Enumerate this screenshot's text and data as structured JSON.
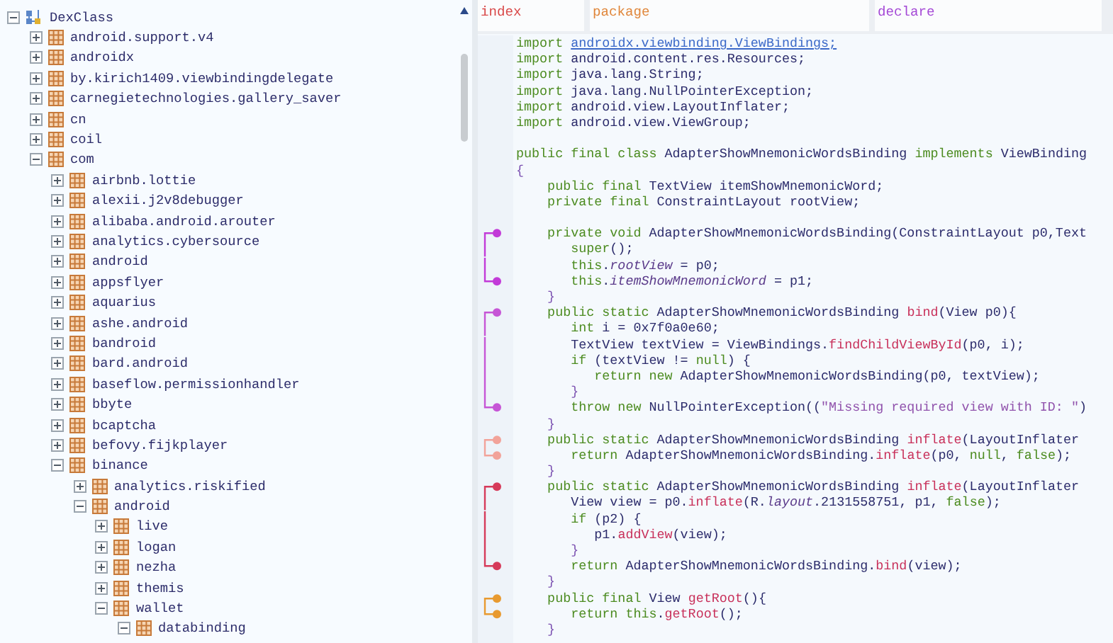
{
  "tree": {
    "label": "DexClass",
    "kind": "root",
    "expanded": true,
    "children": [
      {
        "label": "android.support.v4",
        "kind": "package",
        "expanded": false
      },
      {
        "label": "androidx",
        "kind": "package",
        "expanded": false
      },
      {
        "label": "by.kirich1409.viewbindingdelegate",
        "kind": "package",
        "expanded": false
      },
      {
        "label": "carnegietechnologies.gallery_saver",
        "kind": "package",
        "expanded": false
      },
      {
        "label": "cn",
        "kind": "package",
        "expanded": false
      },
      {
        "label": "coil",
        "kind": "package",
        "expanded": false
      },
      {
        "label": "com",
        "kind": "package",
        "expanded": true,
        "children": [
          {
            "label": "airbnb.lottie",
            "kind": "package",
            "expanded": false
          },
          {
            "label": "alexii.j2v8debugger",
            "kind": "package",
            "expanded": false
          },
          {
            "label": "alibaba.android.arouter",
            "kind": "package",
            "expanded": false
          },
          {
            "label": "analytics.cybersource",
            "kind": "package",
            "expanded": false
          },
          {
            "label": "android",
            "kind": "package",
            "expanded": false
          },
          {
            "label": "appsflyer",
            "kind": "package",
            "expanded": false
          },
          {
            "label": "aquarius",
            "kind": "package",
            "expanded": false
          },
          {
            "label": "ashe.android",
            "kind": "package",
            "expanded": false
          },
          {
            "label": "bandroid",
            "kind": "package",
            "expanded": false
          },
          {
            "label": "bard.android",
            "kind": "package",
            "expanded": false
          },
          {
            "label": "baseflow.permissionhandler",
            "kind": "package",
            "expanded": false
          },
          {
            "label": "bbyte",
            "kind": "package",
            "expanded": false
          },
          {
            "label": "bcaptcha",
            "kind": "package",
            "expanded": false
          },
          {
            "label": "befovy.fijkplayer",
            "kind": "package",
            "expanded": false
          },
          {
            "label": "binance",
            "kind": "package",
            "expanded": true,
            "children": [
              {
                "label": "analytics.riskified",
                "kind": "package",
                "expanded": false
              },
              {
                "label": "android",
                "kind": "package",
                "expanded": true,
                "children": [
                  {
                    "label": "live",
                    "kind": "package",
                    "expanded": false
                  },
                  {
                    "label": "logan",
                    "kind": "package",
                    "expanded": false
                  },
                  {
                    "label": "nezha",
                    "kind": "package",
                    "expanded": false
                  },
                  {
                    "label": "themis",
                    "kind": "package",
                    "expanded": false
                  },
                  {
                    "label": "wallet",
                    "kind": "package",
                    "expanded": true,
                    "children": [
                      {
                        "label": "databinding",
                        "kind": "package",
                        "expanded": true
                      }
                    ]
                  }
                ]
              }
            ]
          }
        ]
      }
    ]
  },
  "columns": [
    {
      "label": "index",
      "color": "#d94848"
    },
    {
      "label": "package",
      "color": "#e0863a"
    },
    {
      "label": "declare",
      "color": "#a448d6"
    }
  ],
  "code_lines": [
    {
      "kind": "code",
      "tokens": [
        {
          "kind": "kw",
          "text": "import "
        },
        {
          "kind": "link",
          "text": "androidx.viewbinding.ViewBindings;"
        }
      ]
    },
    {
      "kind": "code",
      "tokens": [
        {
          "kind": "kw",
          "text": "import "
        },
        {
          "kind": "type",
          "text": "android.content.res.Resources;"
        }
      ]
    },
    {
      "kind": "code",
      "tokens": [
        {
          "kind": "kw",
          "text": "import "
        },
        {
          "kind": "type",
          "text": "java.lang.String;"
        }
      ]
    },
    {
      "kind": "code",
      "tokens": [
        {
          "kind": "kw",
          "text": "import "
        },
        {
          "kind": "type",
          "text": "java.lang.NullPointerException;"
        }
      ]
    },
    {
      "kind": "code",
      "tokens": [
        {
          "kind": "kw",
          "text": "import "
        },
        {
          "kind": "type",
          "text": "android.view.LayoutInflater;"
        }
      ]
    },
    {
      "kind": "code",
      "tokens": [
        {
          "kind": "kw",
          "text": "import "
        },
        {
          "kind": "type",
          "text": "android.view.ViewGroup;"
        }
      ]
    },
    {
      "kind": "blank"
    },
    {
      "kind": "code",
      "tokens": [
        {
          "kind": "kw",
          "text": "public final class "
        },
        {
          "kind": "type",
          "text": "AdapterShowMnemonicWordsBinding "
        },
        {
          "kind": "kw",
          "text": "implements "
        },
        {
          "kind": "type",
          "text": "ViewBinding"
        }
      ]
    },
    {
      "kind": "code",
      "tokens": [
        {
          "kind": "brace",
          "text": "{"
        }
      ]
    },
    {
      "kind": "code",
      "tokens": [
        {
          "kind": "kw",
          "text": "    public final "
        },
        {
          "kind": "type",
          "text": "TextView itemShowMnemonicWord;"
        }
      ]
    },
    {
      "kind": "code",
      "tokens": [
        {
          "kind": "kw",
          "text": "    private final "
        },
        {
          "kind": "type",
          "text": "ConstraintLayout rootView;"
        }
      ]
    },
    {
      "kind": "blank"
    },
    {
      "kind": "code",
      "bracket": {
        "opens": true,
        "closes": false,
        "color": "#c23ad8"
      },
      "tokens": [
        {
          "kind": "kw",
          "text": "    private void "
        },
        {
          "kind": "type",
          "text": "AdapterShowMnemonicWordsBinding(ConstraintLayout p0,Text"
        }
      ]
    },
    {
      "kind": "code",
      "bracket": {
        "opens": false,
        "closes": false,
        "color": "#c23ad8"
      },
      "tokens": [
        {
          "kind": "kw",
          "text": "       super"
        },
        {
          "kind": "type",
          "text": "();"
        }
      ]
    },
    {
      "kind": "code",
      "bracket": {
        "opens": false,
        "closes": false,
        "color": "#c23ad8"
      },
      "tokens": [
        {
          "kind": "kw",
          "text": "       this"
        },
        {
          "kind": "type",
          "text": "."
        },
        {
          "kind": "field",
          "text": "rootView"
        },
        {
          "kind": "type",
          "text": " = p0;"
        }
      ]
    },
    {
      "kind": "code",
      "bracket": {
        "opens": false,
        "closes": true,
        "color": "#c23ad8"
      },
      "tokens": [
        {
          "kind": "kw",
          "text": "       this"
        },
        {
          "kind": "type",
          "text": "."
        },
        {
          "kind": "field",
          "text": "itemShowMnemonicWord"
        },
        {
          "kind": "type",
          "text": " = p1;"
        }
      ]
    },
    {
      "kind": "code",
      "tokens": [
        {
          "kind": "brace",
          "text": "    }"
        }
      ]
    },
    {
      "kind": "code",
      "bracket": {
        "opens": true,
        "closes": false,
        "color": "#c655d6"
      },
      "tokens": [
        {
          "kind": "kw",
          "text": "    public static "
        },
        {
          "kind": "type",
          "text": "AdapterShowMnemonicWordsBinding "
        },
        {
          "kind": "fn",
          "text": "bind"
        },
        {
          "kind": "type",
          "text": "(View p0){"
        }
      ]
    },
    {
      "kind": "code",
      "bracket": {
        "opens": false,
        "closes": false,
        "color": "#c655d6"
      },
      "tokens": [
        {
          "kind": "kw",
          "text": "       int "
        },
        {
          "kind": "type",
          "text": "i = 0x7f0a0e60;"
        }
      ]
    },
    {
      "kind": "code",
      "bracket": {
        "opens": false,
        "closes": false,
        "color": "#c655d6"
      },
      "tokens": [
        {
          "kind": "type",
          "text": "       TextView textView = ViewBindings."
        },
        {
          "kind": "fn",
          "text": "findChildViewById"
        },
        {
          "kind": "type",
          "text": "(p0, i);"
        }
      ]
    },
    {
      "kind": "code",
      "bracket": {
        "opens": false,
        "closes": false,
        "color": "#c655d6"
      },
      "tokens": [
        {
          "kind": "kw",
          "text": "       if "
        },
        {
          "kind": "type",
          "text": "(textView != "
        },
        {
          "kind": "kw",
          "text": "null"
        },
        {
          "kind": "type",
          "text": ") {"
        }
      ]
    },
    {
      "kind": "code",
      "bracket": {
        "opens": false,
        "closes": false,
        "color": "#c655d6"
      },
      "tokens": [
        {
          "kind": "kw",
          "text": "          return new "
        },
        {
          "kind": "type",
          "text": "AdapterShowMnemonicWordsBinding(p0, textView);"
        }
      ]
    },
    {
      "kind": "code",
      "bracket": {
        "opens": false,
        "closes": false,
        "color": "#c655d6"
      },
      "tokens": [
        {
          "kind": "brace",
          "text": "       }"
        }
      ]
    },
    {
      "kind": "code",
      "bracket": {
        "opens": false,
        "closes": true,
        "color": "#c655d6"
      },
      "tokens": [
        {
          "kind": "kw",
          "text": "       throw new "
        },
        {
          "kind": "type",
          "text": "NullPointerException(("
        },
        {
          "kind": "str",
          "text": "\"Missing required view with ID: \""
        },
        {
          "kind": "type",
          "text": ")"
        }
      ]
    },
    {
      "kind": "code",
      "tokens": [
        {
          "kind": "brace",
          "text": "    }"
        }
      ]
    },
    {
      "kind": "code",
      "bracket": {
        "opens": true,
        "closes": false,
        "color": "#f2a39a"
      },
      "tokens": [
        {
          "kind": "kw",
          "text": "    public static "
        },
        {
          "kind": "type",
          "text": "AdapterShowMnemonicWordsBinding "
        },
        {
          "kind": "fn",
          "text": "inflate"
        },
        {
          "kind": "type",
          "text": "(LayoutInflater"
        }
      ]
    },
    {
      "kind": "code",
      "bracket": {
        "opens": false,
        "closes": true,
        "color": "#f2a39a"
      },
      "tokens": [
        {
          "kind": "kw",
          "text": "       return "
        },
        {
          "kind": "type",
          "text": "AdapterShowMnemonicWordsBinding."
        },
        {
          "kind": "fn",
          "text": "inflate"
        },
        {
          "kind": "type",
          "text": "(p0, "
        },
        {
          "kind": "kw",
          "text": "null"
        },
        {
          "kind": "type",
          "text": ", "
        },
        {
          "kind": "kw",
          "text": "false"
        },
        {
          "kind": "type",
          "text": ");"
        }
      ]
    },
    {
      "kind": "code",
      "tokens": [
        {
          "kind": "brace",
          "text": "    }"
        }
      ]
    },
    {
      "kind": "code",
      "bracket": {
        "opens": true,
        "closes": false,
        "color": "#d63a5a"
      },
      "tokens": [
        {
          "kind": "kw",
          "text": "    public static "
        },
        {
          "kind": "type",
          "text": "AdapterShowMnemonicWordsBinding "
        },
        {
          "kind": "fn",
          "text": "inflate"
        },
        {
          "kind": "type",
          "text": "(LayoutInflater"
        }
      ]
    },
    {
      "kind": "code",
      "bracket": {
        "opens": false,
        "closes": false,
        "color": "#d63a5a"
      },
      "tokens": [
        {
          "kind": "type",
          "text": "       View view = p0."
        },
        {
          "kind": "fn",
          "text": "inflate"
        },
        {
          "kind": "type",
          "text": "(R."
        },
        {
          "kind": "field",
          "text": "layout"
        },
        {
          "kind": "type",
          "text": ".2131558751, p1, "
        },
        {
          "kind": "kw",
          "text": "false"
        },
        {
          "kind": "type",
          "text": ");"
        }
      ]
    },
    {
      "kind": "code",
      "bracket": {
        "opens": false,
        "closes": false,
        "color": "#d63a5a"
      },
      "tokens": [
        {
          "kind": "kw",
          "text": "       if "
        },
        {
          "kind": "type",
          "text": "(p2) {"
        }
      ]
    },
    {
      "kind": "code",
      "bracket": {
        "opens": false,
        "closes": false,
        "color": "#d63a5a"
      },
      "tokens": [
        {
          "kind": "type",
          "text": "          p1."
        },
        {
          "kind": "fn",
          "text": "addView"
        },
        {
          "kind": "type",
          "text": "(view);"
        }
      ]
    },
    {
      "kind": "code",
      "bracket": {
        "opens": false,
        "closes": false,
        "color": "#d63a5a"
      },
      "tokens": [
        {
          "kind": "brace",
          "text": "       }"
        }
      ]
    },
    {
      "kind": "code",
      "bracket": {
        "opens": false,
        "closes": true,
        "color": "#d63a5a"
      },
      "tokens": [
        {
          "kind": "kw",
          "text": "       return "
        },
        {
          "kind": "type",
          "text": "AdapterShowMnemonicWordsBinding."
        },
        {
          "kind": "fn",
          "text": "bind"
        },
        {
          "kind": "type",
          "text": "(view);"
        }
      ]
    },
    {
      "kind": "code",
      "tokens": [
        {
          "kind": "brace",
          "text": "    }"
        }
      ]
    },
    {
      "kind": "code",
      "bracket": {
        "opens": true,
        "closes": false,
        "color": "#e89a30"
      },
      "tokens": [
        {
          "kind": "kw",
          "text": "    public final "
        },
        {
          "kind": "type",
          "text": "View "
        },
        {
          "kind": "fn",
          "text": "getRoot"
        },
        {
          "kind": "type",
          "text": "(){"
        }
      ]
    },
    {
      "kind": "code",
      "bracket": {
        "opens": false,
        "closes": true,
        "color": "#e89a30"
      },
      "tokens": [
        {
          "kind": "kw",
          "text": "       return this"
        },
        {
          "kind": "type",
          "text": "."
        },
        {
          "kind": "fn",
          "text": "getRoot"
        },
        {
          "kind": "type",
          "text": "();"
        }
      ]
    },
    {
      "kind": "code",
      "tokens": [
        {
          "kind": "brace",
          "text": "    }"
        }
      ]
    }
  ]
}
